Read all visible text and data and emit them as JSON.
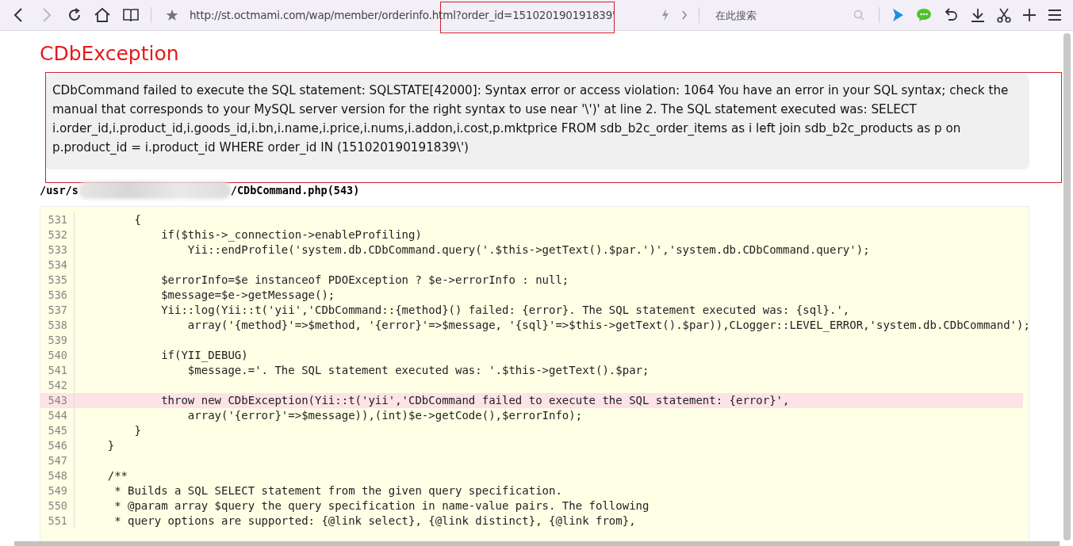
{
  "toolbar": {
    "back": {
      "disabled": false
    },
    "forward": {
      "disabled": true
    },
    "url": "http://st.octmami.com/wap/member/orderinfo.html?order_id=151020190191839'",
    "search": {
      "placeholder": "在此搜索"
    }
  },
  "error": {
    "title": "CDbException",
    "message": "CDbCommand failed to execute the SQL statement: SQLSTATE[42000]: Syntax error or access violation: 1064 You have an error in your SQL syntax; check the manual that corresponds to your MySQL server version for the right syntax to use near '\\')' at line 2. The SQL statement executed was: SELECT i.order_id,i.product_id,i.goods_id,i.bn,i.name,i.price,i.nums,i.addon,i.cost,p.mktprice FROM sdb_b2c_order_items as i left join sdb_b2c_products as p on p.product_id = i.product_id WHERE order_id IN (151020190191839\\')"
  },
  "source": {
    "path_start": "/usr/s",
    "path_end": "/CDbCommand.php(543)"
  },
  "code": [
    {
      "number": "531",
      "text": "        {",
      "selected": false
    },
    {
      "number": "532",
      "text": "            if($this->_connection->enableProfiling)",
      "selected": false
    },
    {
      "number": "533",
      "text": "                Yii::endProfile('system.db.CDbCommand.query('.$this->getText().$par.')','system.db.CDbCommand.query');",
      "selected": false
    },
    {
      "number": "534",
      "selected": false
    },
    {
      "number": "535",
      "text": "            $errorInfo=$e instanceof PDOException ? $e->errorInfo : null;",
      "selected": false
    },
    {
      "number": "536",
      "text": "            $message=$e->getMessage();",
      "selected": false
    },
    {
      "number": "537",
      "text": "            Yii::log(Yii::t('yii','CDbCommand::{method}() failed: {error}. The SQL statement executed was: {sql}.',",
      "selected": false
    },
    {
      "number": "538",
      "text": "                array('{method}'=>$method, '{error}'=>$message, '{sql}'=>$this->getText().$par)),CLogger::LEVEL_ERROR,'system.db.CDbCommand');",
      "selected": false
    },
    {
      "number": "539",
      "selected": false
    },
    {
      "number": "540",
      "text": "            if(YII_DEBUG)",
      "selected": false
    },
    {
      "number": "541",
      "text": "                $message.='. The SQL statement executed was: '.$this->getText().$par;",
      "selected": false
    },
    {
      "number": "542",
      "selected": false
    },
    {
      "number": "543",
      "text": "            throw new CDbException(Yii::t('yii','CDbCommand failed to execute the SQL statement: {error}',",
      "selected": true
    },
    {
      "number": "544",
      "text": "                array('{error}'=>$message)),(int)$e->getCode(),$errorInfo);",
      "selected": false
    },
    {
      "number": "545",
      "text": "        }",
      "selected": false
    },
    {
      "number": "546",
      "text": "    }",
      "selected": false
    },
    {
      "number": "547",
      "selected": false
    },
    {
      "number": "548",
      "text": "    /**",
      "selected": false
    },
    {
      "number": "549",
      "text": "     * Builds a SQL SELECT statement from the given query specification.",
      "selected": false
    },
    {
      "number": "550",
      "text": "     * @param array $query the query specification in name-value pairs. The following",
      "selected": false
    },
    {
      "number": "551",
      "text": "     * query options are supported: {@link select}, {@link distinct}, {@link from},",
      "selected": false
    }
  ]
}
